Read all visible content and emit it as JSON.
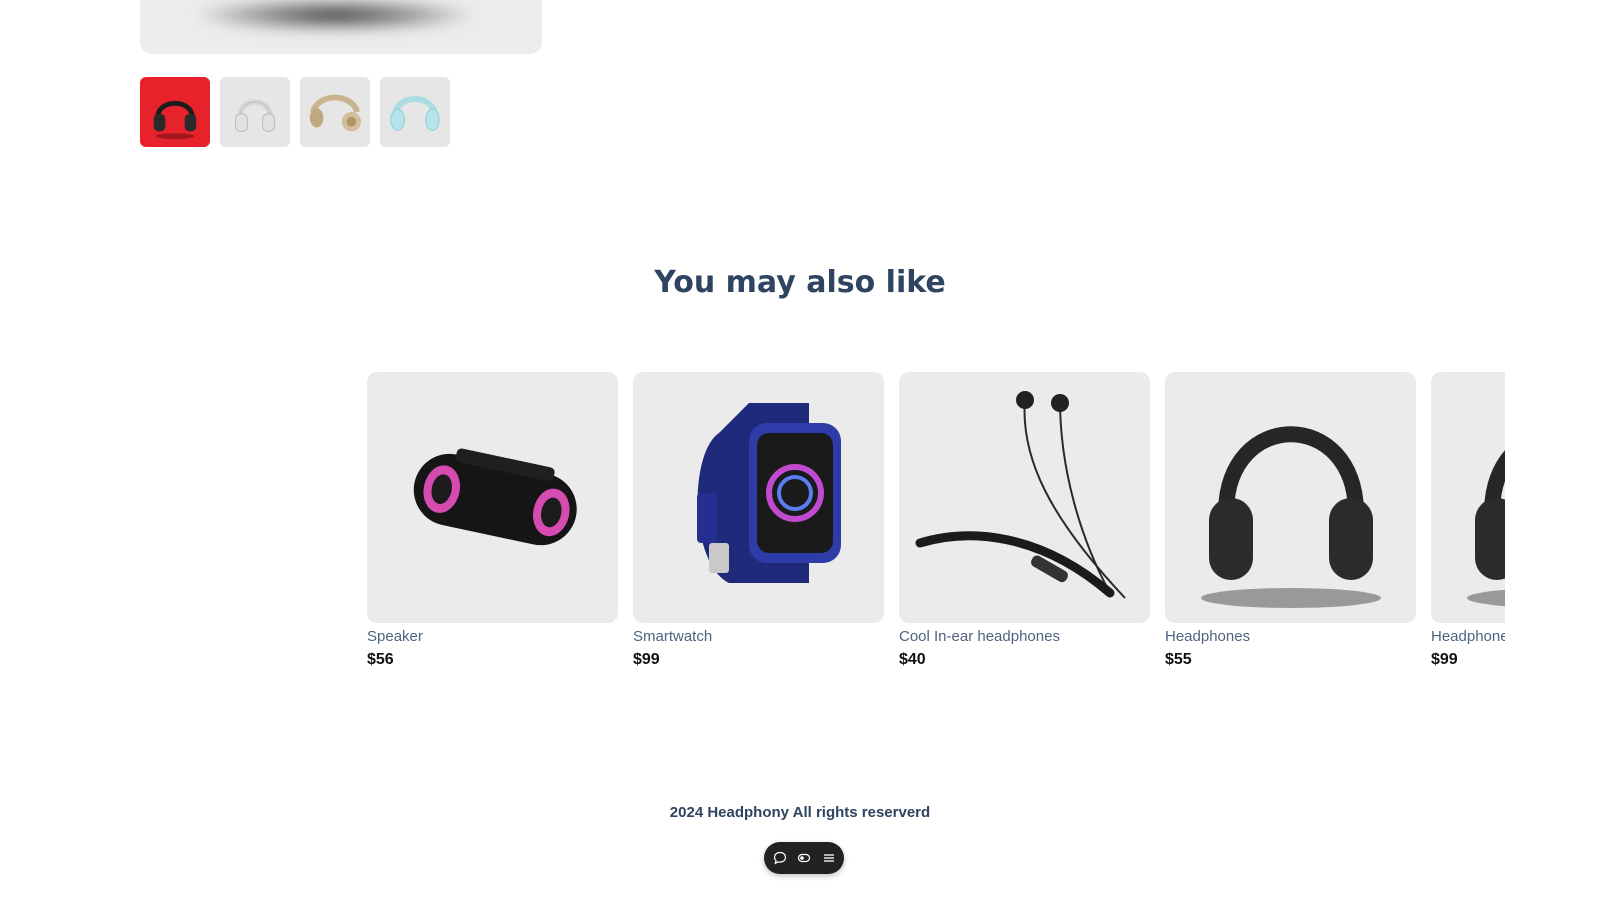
{
  "gallery": {
    "thumbnails": [
      {
        "icon": "headphones-black-red-bg-icon",
        "active": true
      },
      {
        "icon": "headphones-white-icon",
        "active": false
      },
      {
        "icon": "headphones-beige-icon",
        "active": false
      },
      {
        "icon": "headphones-mint-icon",
        "active": false
      }
    ]
  },
  "recommendations": {
    "title": "You may also like",
    "items": [
      {
        "name": "Speaker",
        "price": "$56",
        "icon": "speaker-icon"
      },
      {
        "name": "Smartwatch",
        "price": "$99",
        "icon": "smartwatch-icon"
      },
      {
        "name": "Cool In-ear headphones",
        "price": "$40",
        "icon": "in-ear-headphones-icon"
      },
      {
        "name": "Headphones",
        "price": "$55",
        "icon": "headphones-icon"
      },
      {
        "name": "Headphones",
        "price": "$99",
        "icon": "headphones-icon"
      }
    ]
  },
  "footer": {
    "copyright": "2024 Headphony All rights reserverd"
  },
  "toolbar": {
    "buttons": [
      "chat-icon",
      "toggle-icon",
      "menu-icon"
    ]
  },
  "colors": {
    "accent": "#e8222b",
    "heading": "#2e4460",
    "card_bg": "#ebebeb"
  }
}
